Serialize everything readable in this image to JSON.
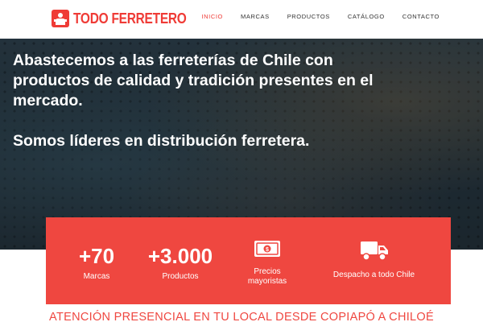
{
  "brand": {
    "name": "TODO FERRETERO",
    "color": "#ef3b36"
  },
  "nav": {
    "items": [
      {
        "label": "INICIO",
        "active": true
      },
      {
        "label": "MARCAS",
        "active": false
      },
      {
        "label": "PRODUCTOS",
        "active": false
      },
      {
        "label": "CATÁLOGO",
        "active": false
      },
      {
        "label": "CONTACTO",
        "active": false
      }
    ]
  },
  "hero": {
    "line1": "Abastecemos a las ferreterías de Chile con productos de calidad y tradición presentes en el mercado.",
    "line2": "Somos líderes en distribución ferretera."
  },
  "stats": {
    "brands": {
      "value": "+70",
      "label": "Marcas"
    },
    "products": {
      "value": "+3.000",
      "label": "Productos"
    },
    "prices": {
      "icon": "money-bill-icon",
      "label": "Precios mayoristas"
    },
    "shipping": {
      "icon": "truck-icon",
      "label": "Despacho a todo Chile"
    }
  },
  "banner": {
    "text": "ATENCIÓN PRESENCIAL EN TU LOCAL DESDE COPIAPÓ A CHILOÉ"
  }
}
